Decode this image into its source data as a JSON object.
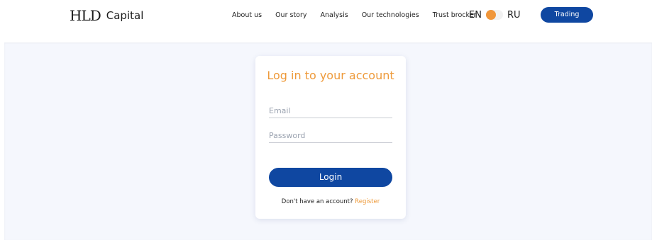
{
  "brand": {
    "mark": "HLD",
    "name": "Capital"
  },
  "nav": {
    "items": [
      {
        "label": "About us"
      },
      {
        "label": "Our story"
      },
      {
        "label": "Analysis"
      },
      {
        "label": "Our technologies"
      },
      {
        "label": "Trust brocker"
      }
    ]
  },
  "language": {
    "left": "EN",
    "right": "RU",
    "selected": "EN"
  },
  "header": {
    "trading_label": "Trading"
  },
  "login": {
    "title": "Log in to your account",
    "email": {
      "placeholder": "Email",
      "value": ""
    },
    "password": {
      "placeholder": "Password",
      "value": ""
    },
    "submit_label": "Login",
    "signup_prompt": "Don't have an account?",
    "register_label": "Register"
  },
  "colors": {
    "accent": "#ee9a3a",
    "primary": "#0f47a1",
    "page_background": "#f5f7fd"
  }
}
